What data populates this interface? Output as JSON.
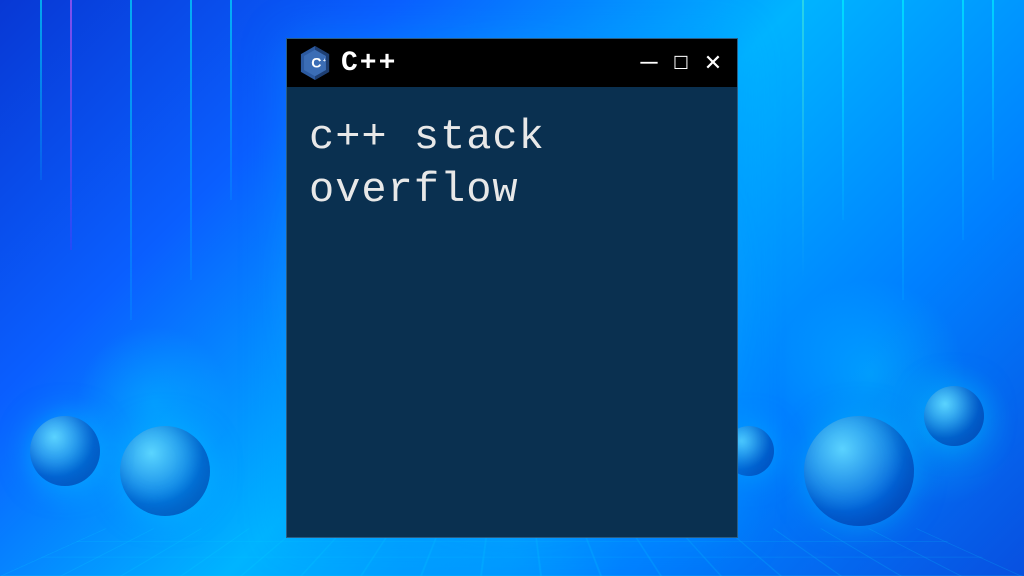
{
  "window": {
    "title": "C++",
    "logo_text": "C++"
  },
  "terminal": {
    "content": "c++ stack overflow"
  },
  "colors": {
    "terminal_bg": "#0a3050",
    "titlebar_bg": "#000000",
    "text": "#e8e8e8"
  }
}
